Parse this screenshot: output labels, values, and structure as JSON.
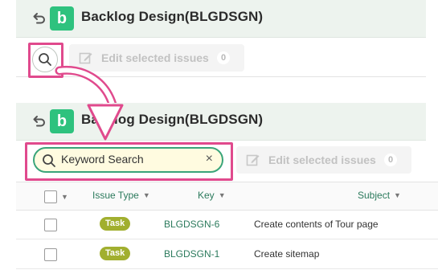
{
  "project": {
    "title": "Backlog Design(BLGDSGN)",
    "icon_letter": "b",
    "brand_color": "#2ec27e"
  },
  "top_panel": {
    "search_button": {
      "icon": "search-icon"
    },
    "edit_button": {
      "label": "Edit selected issues",
      "count": "0"
    }
  },
  "bottom_panel": {
    "search": {
      "value": "Keyword Search",
      "clear_glyph": "×"
    },
    "edit_button": {
      "label": "Edit selected issues",
      "count": "0"
    },
    "table": {
      "columns": [
        "Issue Type",
        "Key",
        "Subject"
      ],
      "rows": [
        {
          "type": "Task",
          "key": "BLGDSGN-6",
          "subject": "Create contents of Tour page"
        },
        {
          "type": "Task",
          "key": "BLGDSGN-1",
          "subject": "Create sitemap"
        }
      ]
    }
  },
  "colors": {
    "highlight": "#e04a8d",
    "task_badge": "#a1af2f",
    "link": "#2b7a5c"
  }
}
